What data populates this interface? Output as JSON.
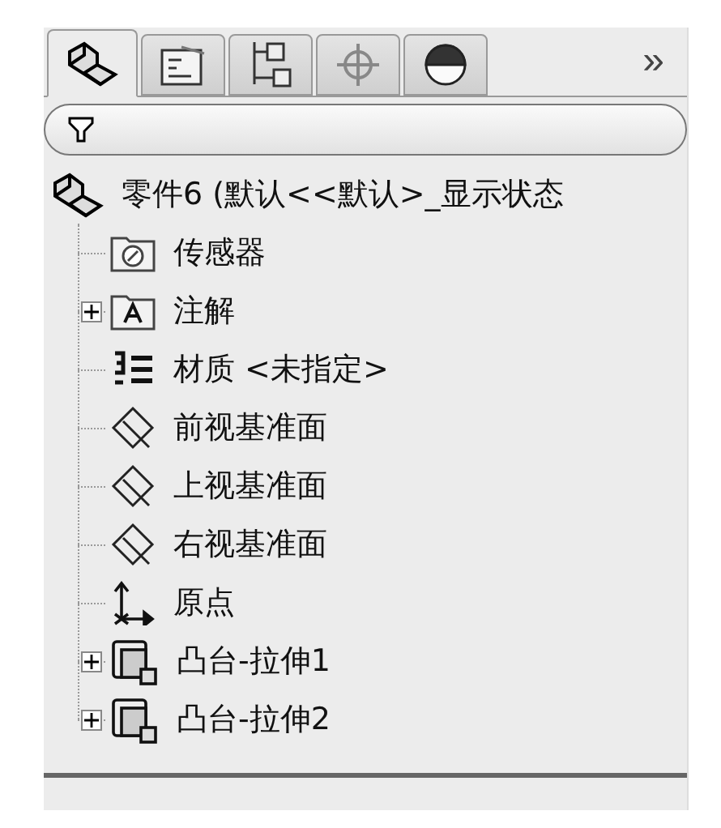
{
  "tabs": [
    {
      "kind": "part",
      "selected": true
    },
    {
      "kind": "properties",
      "selected": false
    },
    {
      "kind": "configurations",
      "selected": false
    },
    {
      "kind": "target",
      "selected": false
    },
    {
      "kind": "appearance",
      "selected": false
    }
  ],
  "overflow": "»",
  "filter": {
    "kind": "filter"
  },
  "tree": {
    "kind": "part",
    "label": "零件6 (默认<<默认>_显示状态",
    "children": [
      {
        "kind": "sensor",
        "label": "传感器",
        "collapsed": false
      },
      {
        "kind": "annotation",
        "label": "注解",
        "collapsed": true
      },
      {
        "kind": "material",
        "label": "材质 <未指定>",
        "collapsed": false
      },
      {
        "kind": "plane",
        "label": "前视基准面",
        "collapsed": false
      },
      {
        "kind": "plane",
        "label": "上视基准面",
        "collapsed": false
      },
      {
        "kind": "plane",
        "label": "右视基准面",
        "collapsed": false
      },
      {
        "kind": "origin",
        "label": "原点",
        "collapsed": false
      },
      {
        "kind": "extrude",
        "label": "凸台-拉伸1",
        "collapsed": true
      },
      {
        "kind": "extrude",
        "label": "凸台-拉伸2",
        "collapsed": true
      }
    ]
  }
}
